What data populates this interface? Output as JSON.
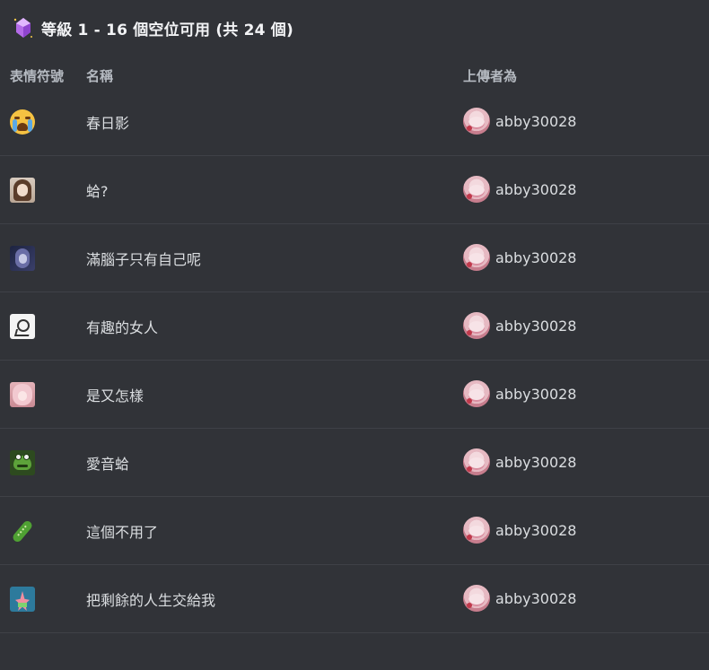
{
  "header": {
    "title": "等級 1 - 16 個空位可用 (共 24 個)",
    "icon": "boost-gem-icon",
    "accent": "#c07cf0"
  },
  "columns": {
    "emoji": "表情符號",
    "name": "名稱",
    "uploader": "上傳者為"
  },
  "rows": [
    {
      "icon": "crying-face-emoji",
      "name": "春日影",
      "uploader": "abby30028"
    },
    {
      "icon": "anime-girl-emoji",
      "name": "蛤?",
      "uploader": "abby30028"
    },
    {
      "icon": "dark-haired-girl-emoji",
      "name": "滿腦子只有自己呢",
      "uploader": "abby30028"
    },
    {
      "icon": "sketch-character-emoji",
      "name": "有趣的女人",
      "uploader": "abby30028"
    },
    {
      "icon": "pink-haired-girl-emoji",
      "name": "是又怎樣",
      "uploader": "abby30028"
    },
    {
      "icon": "kermit-frog-emoji",
      "name": "愛音蛤",
      "uploader": "abby30028"
    },
    {
      "icon": "cucumber-emoji",
      "name": "這個不用了",
      "uploader": "abby30028"
    },
    {
      "icon": "patrick-star-emoji",
      "name": "把剩餘的人生交給我",
      "uploader": "abby30028"
    }
  ],
  "colors": {
    "background": "#313338",
    "divider": "#3f4147",
    "text": "#dbdee1",
    "muted": "#b5bac1"
  }
}
